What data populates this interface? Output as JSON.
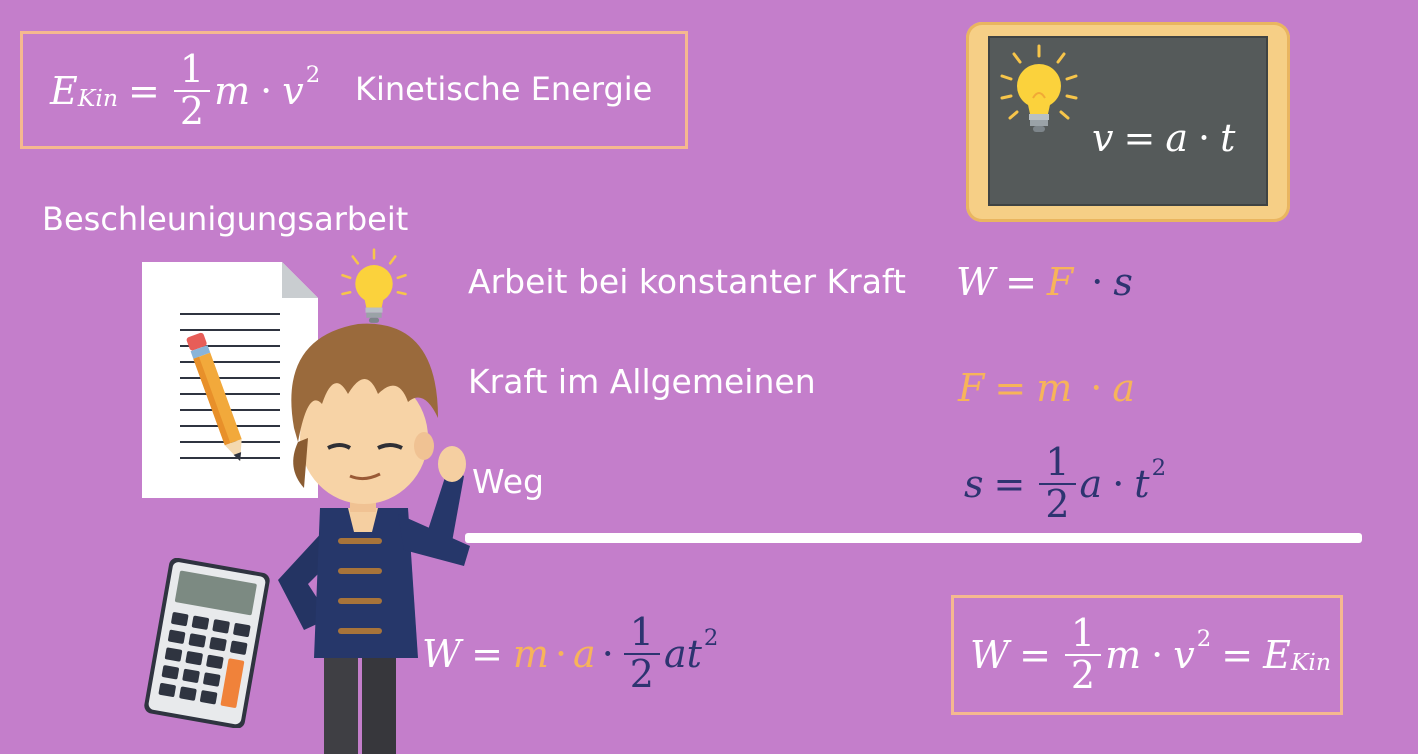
{
  "top_left_box": {
    "formula": {
      "lhs": "E",
      "lhs_sub": "Kin",
      "eq": "=",
      "frac_num": "1",
      "frac_den": "2",
      "m": "m",
      "dot": "·",
      "v": "v",
      "exp": "2"
    },
    "label": "Kinetische Energie"
  },
  "chalkboard": {
    "formula": {
      "lhs": "v",
      "eq": "=",
      "a": "a",
      "dot": "·",
      "t": "t"
    }
  },
  "section_title": "Beschleunigungsarbeit",
  "rows": [
    {
      "label": "Arbeit bei konstanter Kraft",
      "formula": {
        "lhs": "W",
        "eq": "=",
        "f": "F",
        "dot": "·",
        "s": "s"
      }
    },
    {
      "label": "Kraft im Allgemeinen",
      "formula": {
        "lhs": "F",
        "eq": "=",
        "m": "m",
        "dot": "·",
        "a": "a"
      }
    },
    {
      "label": "Weg",
      "formula": {
        "lhs": "s",
        "eq": "=",
        "frac_num": "1",
        "frac_den": "2",
        "a": "a",
        "dot": "·",
        "t": "t",
        "exp": "2"
      }
    }
  ],
  "derivation": {
    "lhs": "W",
    "eq": "=",
    "m": "m",
    "dot1": "·",
    "a": "a",
    "dot2": "·",
    "frac_num": "1",
    "frac_den": "2",
    "at": "at",
    "exp": "2"
  },
  "result_box": {
    "lhs": "W",
    "eq1": "=",
    "frac_num": "1",
    "frac_den": "2",
    "m": "m",
    "dot": "·",
    "v": "v",
    "exp": "2",
    "eq2": "=",
    "rhs": "E",
    "rhs_sub": "Kin"
  },
  "colors": {
    "background": "#c47ecb",
    "box_border": "#f5b98f",
    "highlight": "#f7b45a",
    "navy": "#2d3470",
    "chalkboard_frame": "#f6cf86",
    "chalkboard_surface": "#555a5a"
  },
  "icons": [
    "lightbulb-icon",
    "document-icon",
    "pencil-icon",
    "calculator-icon",
    "student-character"
  ]
}
